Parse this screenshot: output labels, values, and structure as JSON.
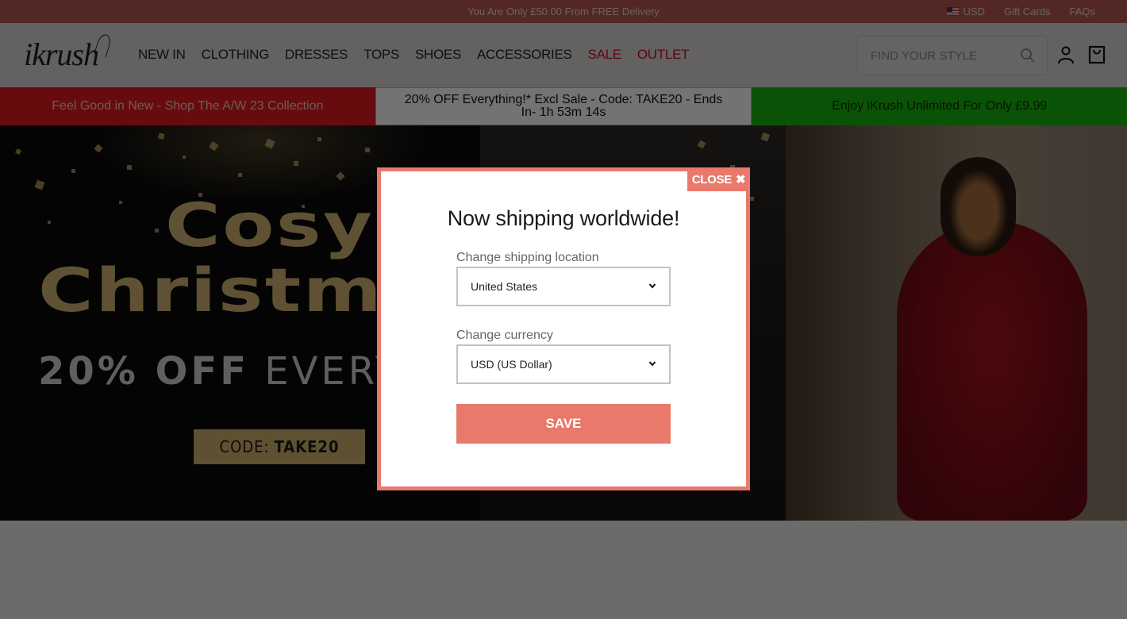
{
  "topbar": {
    "delivery_message": "You Are Only £50.00 From FREE Delivery",
    "currency": "USD",
    "flag_icon": "us-flag-icon",
    "links": [
      "Gift Cards",
      "FAQs"
    ]
  },
  "header": {
    "logo": "ikrush",
    "nav": [
      {
        "label": "NEW IN",
        "highlight": false
      },
      {
        "label": "CLOTHING",
        "highlight": false
      },
      {
        "label": "DRESSES",
        "highlight": false
      },
      {
        "label": "TOPS",
        "highlight": false
      },
      {
        "label": "SHOES",
        "highlight": false
      },
      {
        "label": "ACCESSORIES",
        "highlight": false
      },
      {
        "label": "SALE",
        "highlight": true
      },
      {
        "label": "OUTLET",
        "highlight": true
      }
    ],
    "search_placeholder": "FIND YOUR STYLE",
    "icons": [
      "search-icon",
      "account-icon",
      "bag-icon"
    ],
    "highlight_color": "#c8102e"
  },
  "promos": [
    {
      "text": "Feel Good in New - Shop The A/W 23 Collection",
      "color": "#e31b23"
    },
    {
      "text": "20% OFF Everything!* Excl Sale - Code: TAKE20 - Ends In- 1h 53m 14s",
      "color": "#ffffff"
    },
    {
      "text": "Enjoy iKrush Unlimited For Only £9.99",
      "color": "#17b80e"
    }
  ],
  "hero": {
    "line1": "Cosy",
    "line2": "Christm",
    "offer_bold": "20% OFF",
    "offer_light": " EVERY",
    "code_label": "CODE:",
    "code_value": "TAKE20"
  },
  "modal": {
    "close_label": "CLOSE",
    "close_icon": "close-icon",
    "title": "Now shipping worldwide!",
    "location_label": "Change shipping location",
    "location_value": "United States",
    "currency_label": "Change currency",
    "currency_value": "USD (US Dollar)",
    "save_label": "SAVE",
    "accent_color": "#e8796b"
  }
}
